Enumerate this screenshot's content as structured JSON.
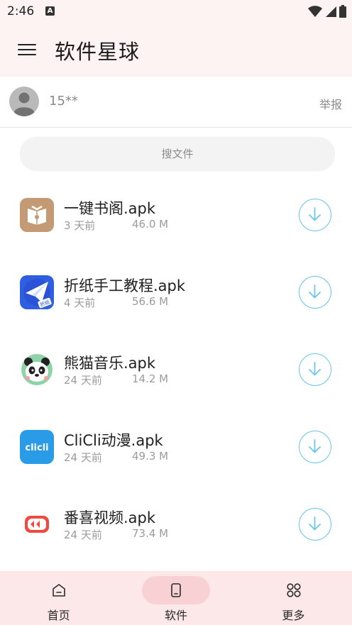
{
  "status_bar": {
    "time": "2:46",
    "notification_letter": "A"
  },
  "app_bar": {
    "title": "软件星球",
    "menu_icon": "hamburger-icon"
  },
  "user": {
    "name": "15**",
    "report_label": "举报"
  },
  "search": {
    "placeholder": "搜文件"
  },
  "files": [
    {
      "name": "一键书阁.apk",
      "age": "3 天前",
      "size": "46.0 M",
      "icon": "book-app-icon"
    },
    {
      "name": "折纸手工教程.apk",
      "age": "4 天前",
      "size": "56.6 M",
      "icon": "paper-plane-app-icon"
    },
    {
      "name": "熊猫音乐.apk",
      "age": "24 天前",
      "size": "14.2 M",
      "icon": "panda-app-icon"
    },
    {
      "name": "CliCli动漫.apk",
      "age": "24 天前",
      "size": "49.3 M",
      "icon": "clicli-app-icon"
    },
    {
      "name": "番喜视频.apk",
      "age": "24 天前",
      "size": "73.4 M",
      "icon": "video-app-icon"
    }
  ],
  "bottom_nav": [
    {
      "label": "首页",
      "icon": "home-icon",
      "active": false
    },
    {
      "label": "软件",
      "icon": "phone-icon",
      "active": true
    },
    {
      "label": "更多",
      "icon": "grid-icon",
      "active": false
    }
  ],
  "colors": {
    "accent": "#6cc6ee",
    "header_bg": "#fdf3f2",
    "nav_bg": "#fce8e9",
    "nav_active": "#f7d1d4"
  }
}
